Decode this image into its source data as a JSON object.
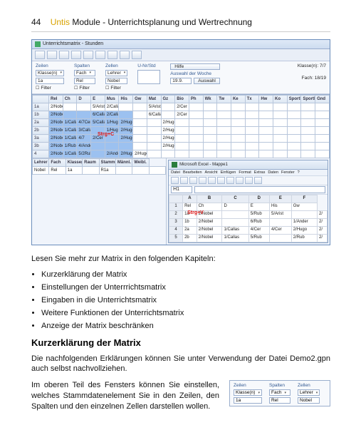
{
  "page_number": "44",
  "brand": "Untis",
  "header_rest": " Module - Unterrichtsplanung und Wertrechnung",
  "main_window": {
    "title": "Unterrichtsmatrix - Stunden",
    "controls": {
      "zeilen_label": "Zeilen",
      "zeilen_sel": "Klasse(n)",
      "spalten_label": "Spalten",
      "spalten_sel": "Fach",
      "zellen_label": "Zellen",
      "zellen_sel": "Lehrer",
      "row2_zeilen": "1a",
      "row2_spalten": "Rel",
      "row2_zellen": "Nobel",
      "filter_label": "Filter",
      "unr_label": "U-Nr/Std",
      "unr_value": "",
      "hilfe": "Hilfe",
      "klassen_label": "Klasse(n): 7/7",
      "auswahl_label": "Auswahl der Woche",
      "auswahl_value": "19.9.",
      "auswahl_btn": "Auswahl",
      "fach_label": "Fach: 18/19"
    },
    "grid": {
      "cols": [
        "Rel",
        "Ch",
        "D",
        "E",
        "Mus",
        "His",
        "Gw",
        "Mat",
        "Gz",
        "Bio",
        "Ph",
        "Wk",
        "Tw",
        "Ke",
        "Tx",
        "Hw",
        "Ko",
        "SportK",
        "SportM",
        "Gnd"
      ],
      "rows": [
        "1a",
        "1b",
        "2a",
        "2b",
        "3a",
        "3b",
        "4"
      ],
      "cells": {
        "1a": [
          "2/Nobel",
          "",
          "",
          "5/Arist",
          "2/Callas",
          "",
          "",
          "5/Arist",
          "",
          "2/Cer",
          "",
          "",
          "",
          "",
          "",
          "",
          "",
          "",
          "",
          ""
        ],
        "1b": [
          "2/Nobel",
          "",
          "",
          "6/Callas",
          "2/Callas",
          "",
          "",
          "6/Callas",
          "",
          "2/Cer",
          "",
          "",
          "",
          "",
          "",
          "",
          "",
          "",
          "",
          ""
        ],
        "2a": [
          "2/Nobel",
          "1/Callas",
          "4/7Cer",
          "5/Callas",
          "1/Hugo",
          "2/Hugo",
          "",
          "",
          "2/Hugo",
          "",
          "",
          "",
          "",
          "",
          "",
          "",
          "",
          "",
          "",
          ""
        ],
        "2b": [
          "2/Nobel",
          "1/Callas",
          "3/Callas/4/7",
          "",
          "1/Hugo",
          "2/Hugo",
          "",
          "",
          "2/Hugo",
          "",
          "",
          "",
          "",
          "",
          "",
          "",
          "",
          "",
          "",
          ""
        ],
        "3a": [
          "2/Nobel",
          "1/Callas",
          "4/7",
          "2/Cer",
          "",
          "2/Hugo",
          "",
          "",
          "2/Hugo",
          "",
          "",
          "",
          "",
          "",
          "",
          "",
          "",
          "",
          "",
          ""
        ],
        "3b": [
          "2/Nobel",
          "1/Rub",
          "4/Ander",
          "",
          "",
          "",
          "",
          "",
          "2/Hugo",
          "",
          "",
          "",
          "",
          "",
          "",
          "",
          "",
          "",
          "",
          ""
        ],
        "4": [
          "2/Nobel",
          "1/Callas",
          "5/2Rub",
          "",
          "2/Ander",
          "2/Hugo",
          "2/Hugo",
          "",
          "",
          "",
          "",
          "",
          "",
          "",
          "",
          "",
          "",
          "",
          "",
          ""
        ]
      },
      "shortcut_note": "Strg+C"
    },
    "detail": {
      "cols": [
        "Lehrer",
        "Fach",
        "Klasse(n)",
        "Raum",
        "Stammraum",
        "Männl.",
        "Weibl."
      ],
      "row": [
        "Nobel",
        "Rel",
        "1a",
        "",
        "R1a",
        "",
        "",
        ""
      ]
    },
    "excel": {
      "title": "Microsoft Excel - Mappe1",
      "menu": [
        "Datei",
        "Bearbeiten",
        "Ansicht",
        "Einfügen",
        "Format",
        "Extras",
        "Daten",
        "Fenster",
        "?"
      ],
      "cell_ref": "H1",
      "cols": [
        "A",
        "B",
        "C",
        "D",
        "E",
        "F"
      ],
      "col_labels_row1": [
        "",
        "Rel",
        "Ch",
        "D",
        "E",
        "His",
        "Gw"
      ],
      "rows": [
        [
          "1a",
          "2/Nobel",
          "",
          "5/Rub",
          "5/Arist",
          "",
          "2/"
        ],
        [
          "1b",
          "2/Nobel",
          "",
          "6/Rub",
          "",
          "1/Ander",
          "2/"
        ],
        [
          "2a",
          "2/Nobel",
          "1/Callas",
          "4/Cer",
          "4/Cer",
          "2/Hugo",
          "2/"
        ],
        [
          "2b",
          "2/Nobel",
          "1/Callas",
          "5/Rub",
          "",
          "2/Rub",
          "2/"
        ]
      ],
      "shortcut_note": "Strg+V"
    }
  },
  "para_intro": "Lesen Sie mehr zur Matrix in den folgenden Kapiteln:",
  "bullets": [
    "Kurzerklärung der Matrix",
    "Einstellungen der Unterrrichtsmatrix",
    "Eingaben in die Unterrichtsmatrix",
    "Weitere Funktionen der Unterrichtsmatrix",
    "Anzeige der Matrix beschränken"
  ],
  "section_heading": "Kurzerklärung der Matrix",
  "para_explain": "Die nachfolgenden Erklärungen können Sie unter Verwendung der Datei Demo2.gpn auch selbst nachvollziehen.",
  "para_upper": "Im oberen Teil des Fensters können Sie einstellen, welches Stammdatenelement Sie in den Zeilen, den Spalten und den einzelnen Zellen darstellen wollen.",
  "mini": {
    "zeilen_label": "Zeilen",
    "zeilen_sel": "Klasse(n)",
    "zeilen_val": "1a",
    "spalten_label": "Spalten",
    "spalten_sel": "Fach",
    "spalten_val": "Rel",
    "zellen_label": "Zellen",
    "zellen_sel": "Lehrer",
    "zellen_val": "Nobel"
  }
}
